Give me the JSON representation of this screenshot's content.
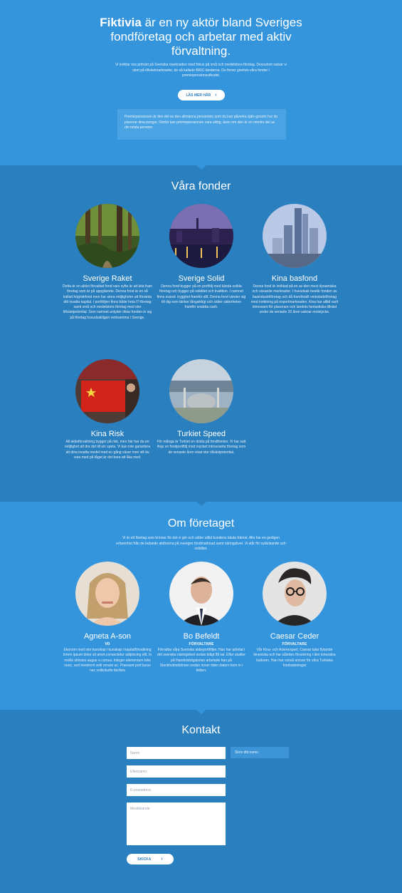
{
  "hero": {
    "brand": "Fiktivia",
    "headline": "är en ny aktör bland Sveriges fondföretag och arbetar med aktiv förvaltning.",
    "intro": "Vi inriktar oss primärt på Svenska marknaden med fokus på små och medelstora företag. Dessutom satsar vi stort på tillväxtmarknader, de så kallade BRIC-länderna. Du finner givetvis våra fonder i premiepensionsutbudet.",
    "more_button": "LÄS MER HÄR",
    "note": "Premiepensionen är den del av den allmänna pensionen som du kan påverka själv genom hur du placerar dina pengar. Därför kan premiepensionen vara viktig, även om den är en mindre del av din totala pension."
  },
  "funds": {
    "title": "Våra fonder",
    "items": [
      {
        "name": "Sverige Raket",
        "desc": "Detta är en aktivt förvaltad fond vars syfte är att leta fram företag som är på uppgående. Denna fond är en så kallad högriskfond men har stora möjligheter att förränta ditt insatta kapital. I portföljen finns både heta IT-företag samt små och medelstora företag med stor tillväxtpotential. Som namnet antyder riktar fonden in sig på företag huvudsakligen verksamma i Sverige."
      },
      {
        "name": "Sverige Solid",
        "desc": "Denna fond bygger på en portfölj med kända solida företag och bygger på soliditet och tradition. I namnet finns svaret: trygghet framför allt. Denna fond vänder sig till dig som tänker långsiktigt och sätter säkerheten framför snabba cash."
      },
      {
        "name": "Kina basfond",
        "desc": "Denna fond är inriktad på en av den mest dynamiska och växande marknader. I huvudsak består fonden av basindustriföretag och då framförallt verkstadsföretag med inriktning på exportmarknaden. Kina har alltid varit intressant för placerare och landets fantastiska tillväxt under de senaste 20 åren saknar motstycke."
      },
      {
        "name": "Kina Risk",
        "desc": "All aktieförvaltning bygger på risk, men här har du en möjlighet att dra det till sin spets. Vi kan inte garantera att dina insatta medel med en gång växer men vill du vara med på tåget är det bara att åka med."
      },
      {
        "name": "Turkiet Speed",
        "desc": "För många är Turkiet en dolda på fondhimlen. Vi har satt ihop en fondportfölj med mycket intressanta företag som de senaste åren visat stor tillväxtpotential."
      }
    ]
  },
  "about": {
    "title": "Om företaget",
    "lead": "Vi är ett företag som brinner för det vi gör och sätter alltid kundens bästa främst. Alla har en gedigen erfarenhet från de ledande aktörerna på sveriges fondmarknad samt näringslivet. Vi står för nytänkande och soliditet.",
    "people": [
      {
        "name": "Agneta A-son",
        "role": "VD",
        "desc": "Ekonom med stor kunskap i kunskap i kapitalförvaltning lorem ipsum dolor sit amet,consectetur adipiscing elit. In mollis ultricies augue a cursus. Integer elementum felis nunc, sed hendrerit velit ornare ac. Praesent port lacus nec sollicitudin facilisis"
      },
      {
        "name": "Bo Befeldt",
        "role": "FÖRVALTARE",
        "desc": "Förvaltar våra Svenska aktieportföljer. Han har arbetat i det svenska näringslivet sedan tidigt 80-tal. Efter studier på Handelshögskolan arbetade han på Stockholmsbörsen nedan innan tiden datorn kom in i bilden."
      },
      {
        "name": "Caesar Ceder",
        "role": "FÖRVALTARE",
        "desc": "Vår Kina- och Asienexpert, Caesar talar flytande kinesiska och har således förankring i den kinesiska kulturen. Han har också ansvar för våra Turkiska fondsatsningar"
      }
    ]
  },
  "contact": {
    "title": "Kontakt",
    "name_placeholder": "Namn",
    "lastname_placeholder": "Efternamn",
    "email_placeholder": "E-postadress",
    "message_placeholder": "Meddelande",
    "hint": "Skriv ditt namn",
    "send_button": "SKICKA"
  },
  "colors": {
    "hero_bg": "#3495dc",
    "funds_bg": "#2a7fbe",
    "accent": "#2d7fc0"
  }
}
